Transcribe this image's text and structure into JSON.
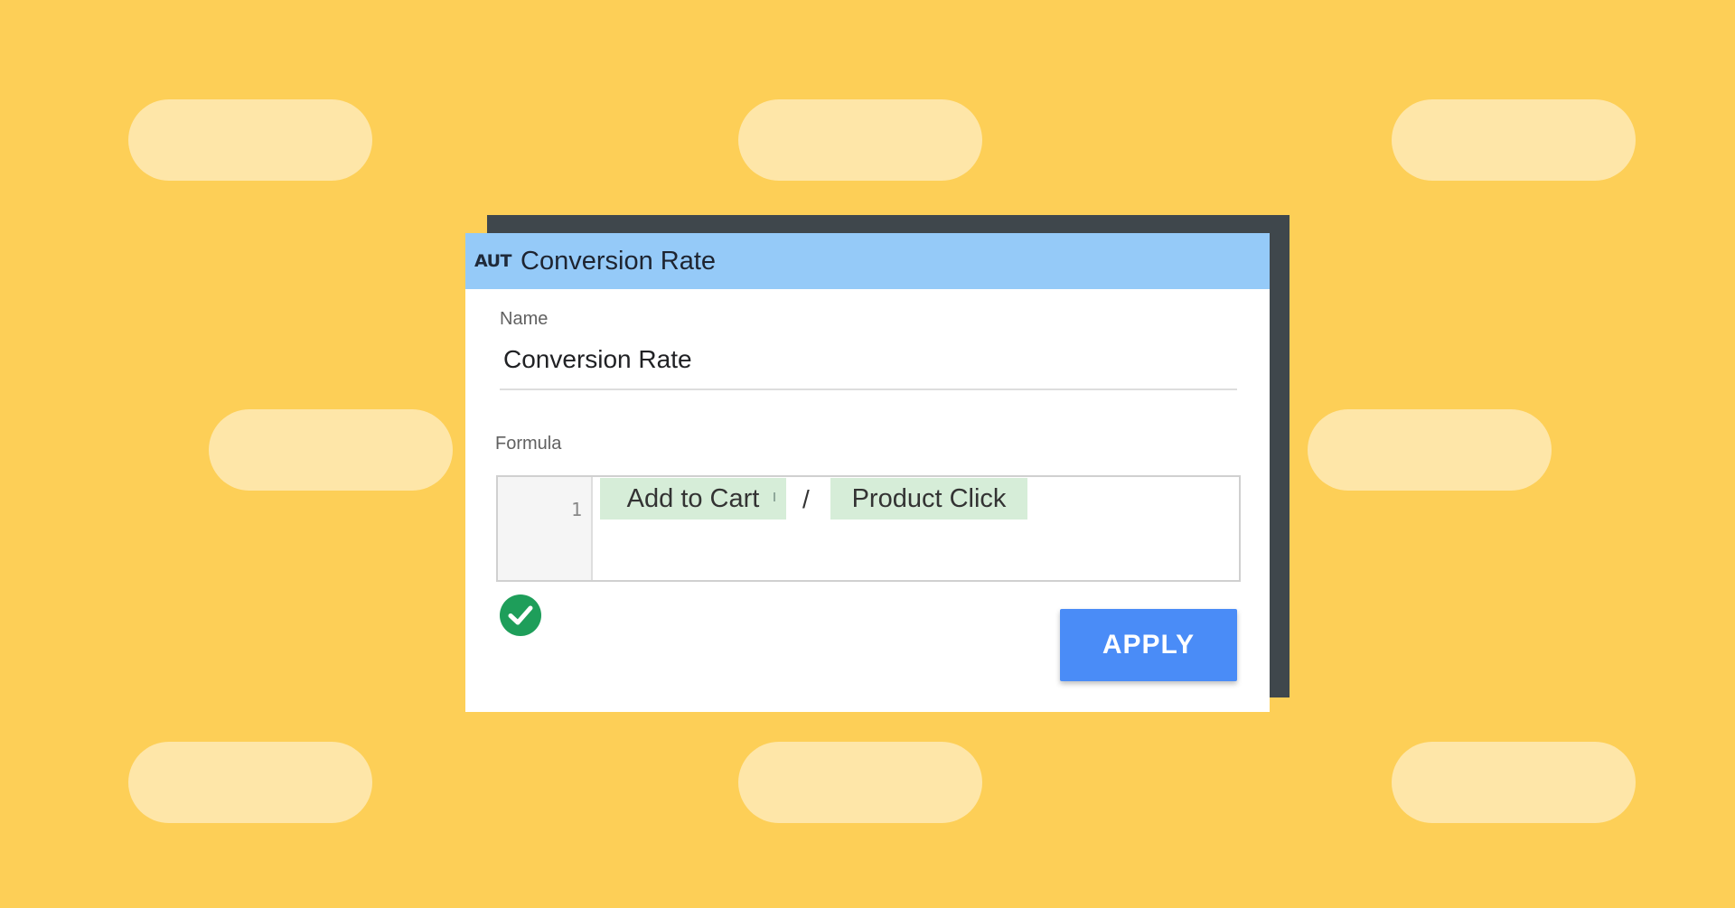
{
  "colors": {
    "background": "#FDCF57",
    "placeholder_pill": "#FEE6A8",
    "dialog_shadow": "#3F474C",
    "header": "#95CAF8",
    "token": "#D6EDD8",
    "apply": "#4A8CF7",
    "valid": "#1E9E5A"
  },
  "dialog": {
    "type_icon": "AUT",
    "title": "Conversion Rate",
    "name_label": "Name",
    "name_value": "Conversion Rate",
    "formula_label": "Formula",
    "formula": {
      "line_number": "1",
      "tokens": [
        "Add to Cart",
        "Product Click"
      ],
      "operator": "/"
    },
    "valid_icon": "check-circle-icon",
    "apply_label": "APPLY"
  }
}
